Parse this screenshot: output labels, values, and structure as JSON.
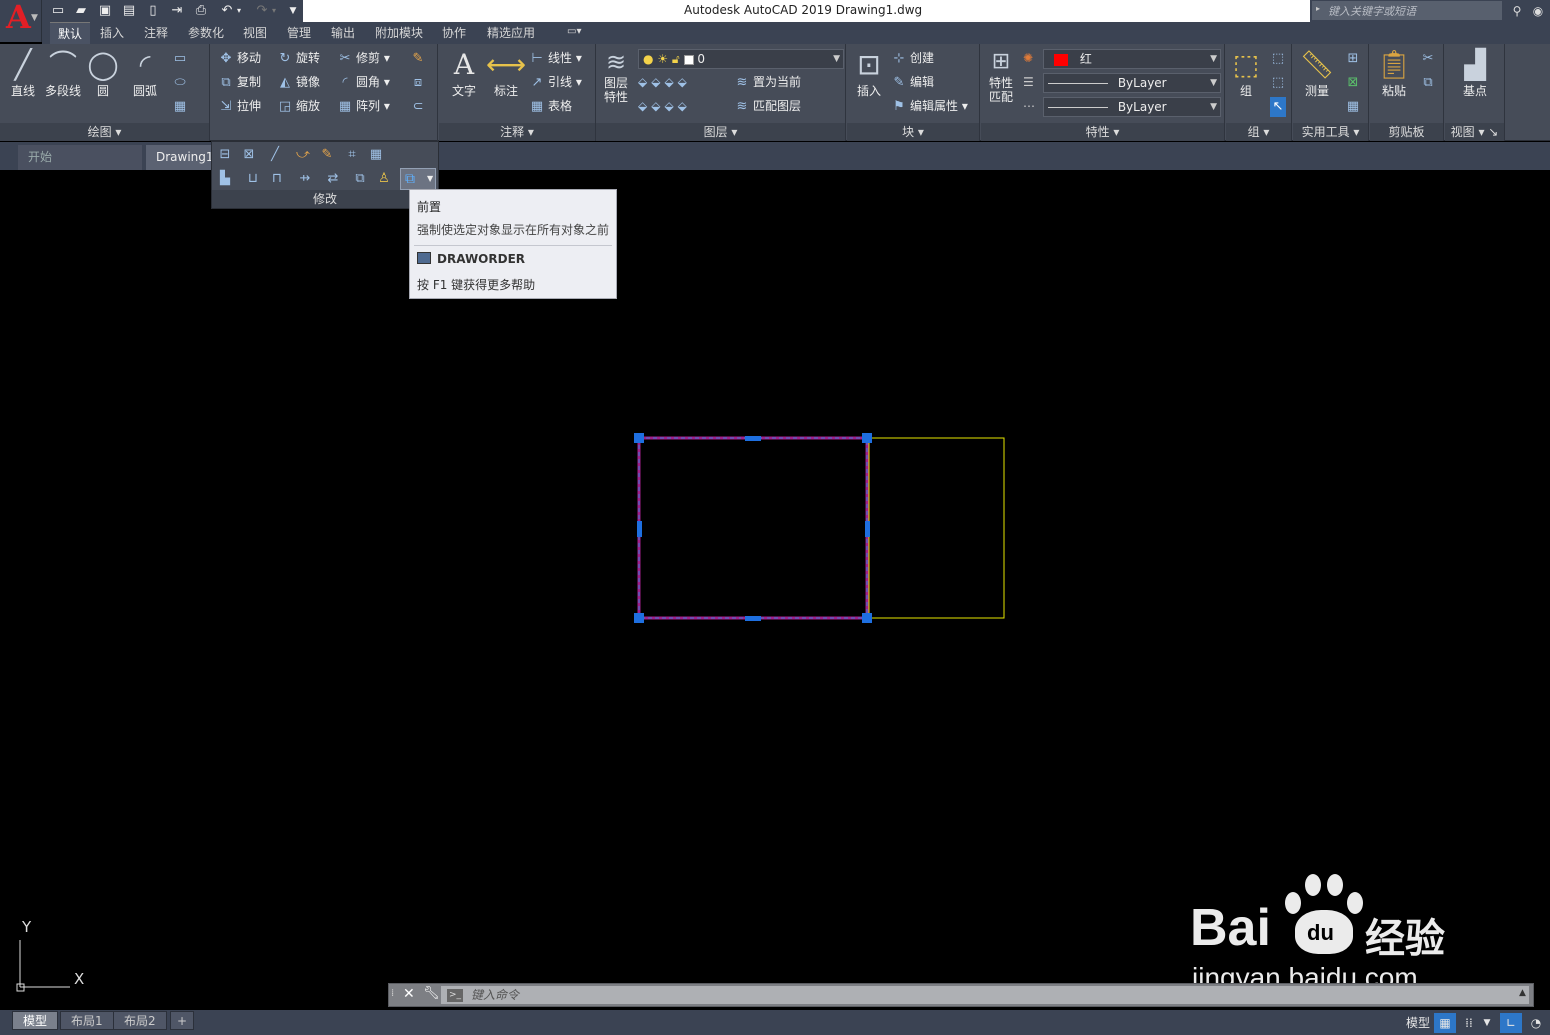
{
  "app": {
    "title": "Autodesk AutoCAD 2019    Drawing1.dwg",
    "logo": "A"
  },
  "quick_access": {
    "icons": [
      "new-icon",
      "open-icon",
      "save-icon",
      "save-as-icon",
      "plot-preview-icon",
      "export-icon",
      "print-icon",
      "undo-icon",
      "redo-icon",
      "customize-icon"
    ]
  },
  "search": {
    "placeholder": "键入关键字或短语"
  },
  "ribbon_tabs": [
    "默认",
    "插入",
    "注释",
    "参数化",
    "视图",
    "管理",
    "输出",
    "附加模块",
    "协作",
    "精选应用"
  ],
  "ribbon": {
    "draw": {
      "label": "绘图",
      "line": "直线",
      "polyline": "多段线",
      "circle": "圆",
      "arc": "圆弧"
    },
    "modify": {
      "label": "修改",
      "move": "移动",
      "rotate": "旋转",
      "trim": "修剪",
      "copy": "复制",
      "mirror": "镜像",
      "fillet": "圆角",
      "stretch": "拉伸",
      "scale": "缩放",
      "array": "阵列"
    },
    "annotation": {
      "label": "注释",
      "text": "文字",
      "dimension": "标注",
      "linear": "线性",
      "leader": "引线",
      "table": "表格"
    },
    "layers": {
      "label": "图层",
      "props_line1": "图层",
      "props_line2": "特性",
      "current_layer": "0",
      "set_current": "置为当前",
      "match_layer": "匹配图层"
    },
    "block": {
      "label": "块",
      "insert": "插入",
      "create": "创建",
      "edit": "编辑",
      "edit_attr": "编辑属性"
    },
    "properties": {
      "label": "特性",
      "match_line1": "特性",
      "match_line2": "匹配",
      "color": "红",
      "color_hex": "#ff0000",
      "linetype": "ByLayer",
      "lineweight": "ByLayer"
    },
    "groups": {
      "label": "组",
      "group": "组"
    },
    "utilities": {
      "label": "实用工具",
      "measure": "测量"
    },
    "clipboard": {
      "label": "剪贴板",
      "paste": "粘贴"
    },
    "view": {
      "label": "视图",
      "base": "基点"
    }
  },
  "doc_tabs": {
    "start": "开始",
    "drawing": "Drawing1"
  },
  "tooltip": {
    "title": "前置",
    "description": "强制使选定对象显示在所有对象之前",
    "command": "DRAWORDER",
    "help": "按 F1 键获得更多帮助"
  },
  "ucs": {
    "y_label": "Y",
    "x_label": "X"
  },
  "command_line": {
    "placeholder": "键入命令"
  },
  "layout_tabs": [
    "模型",
    "布局1",
    "布局2"
  ],
  "status_bar": {
    "model": "模型"
  },
  "watermark": {
    "brand": "Bai",
    "du": "du",
    "suffix": "经验",
    "url": "jingyan.baidu.com"
  },
  "colors": {
    "ribbon_bg": "#464c58",
    "title_bg": "#3b4353",
    "selected_rect": "#a0208a",
    "grip": "#1e6fe0",
    "yellow_rect": "#e6e600"
  }
}
